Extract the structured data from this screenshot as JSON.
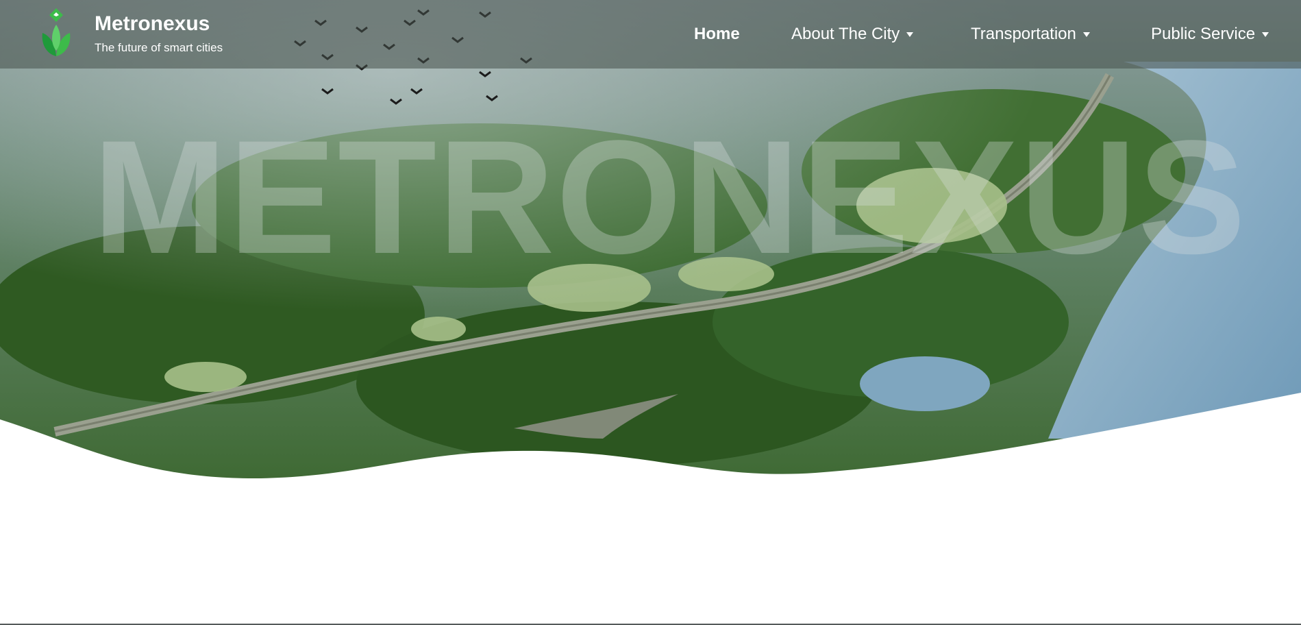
{
  "header": {
    "brand_name": "Metronexus",
    "tagline": "The future of smart cities",
    "logo_icon": "leaf-icon"
  },
  "nav": {
    "items": [
      {
        "label": "Home",
        "active": true,
        "has_dropdown": false
      },
      {
        "label": "About The City",
        "active": false,
        "has_dropdown": true
      },
      {
        "label": "Transportation",
        "active": false,
        "has_dropdown": true
      },
      {
        "label": "Public Service",
        "active": false,
        "has_dropdown": true
      }
    ]
  },
  "hero": {
    "watermark_text": "METRONEXUS"
  },
  "colors": {
    "logo_green": "#3dbb4a",
    "logo_dark_green": "#1f9a3a",
    "nav_text": "#ffffff",
    "river_blue": "#7fa8c4"
  }
}
